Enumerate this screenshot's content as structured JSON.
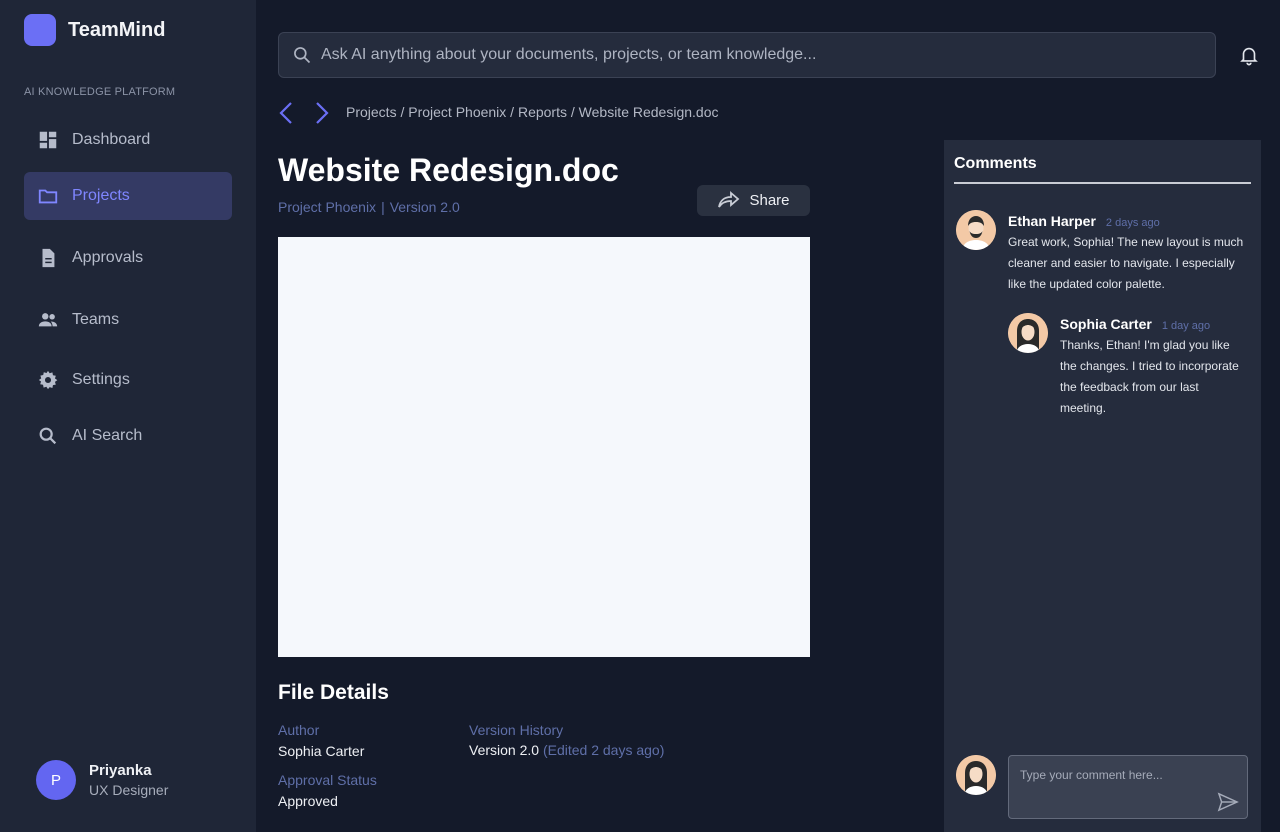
{
  "brand": {
    "name": "TeamMind",
    "logo_color": "#6b6ff5"
  },
  "sidebar": {
    "section_label": "AI KNOWLEDGE PLATFORM",
    "items": [
      {
        "label": "Dashboard",
        "icon": "dashboard-icon",
        "active": false
      },
      {
        "label": "Projects",
        "icon": "folder-icon",
        "active": true
      },
      {
        "label": "Approvals",
        "icon": "document-icon",
        "active": false
      },
      {
        "label": "Teams",
        "icon": "people-icon",
        "active": false
      },
      {
        "label": "Settings",
        "icon": "gear-icon",
        "active": false
      },
      {
        "label": "AI Search",
        "icon": "search-icon",
        "active": false
      }
    ],
    "user": {
      "initial": "P",
      "name": "Priyanka",
      "role": "UX Designer"
    }
  },
  "search": {
    "placeholder": "Ask AI anything about your documents, projects, or team knowledge..."
  },
  "breadcrumb": {
    "path": "Projects / Project Phoenix / Reports /  Website Redesign.doc"
  },
  "document": {
    "title": "Website Redesign.doc",
    "project": "Project Phoenix",
    "version": "Version 2.0",
    "share_label": "Share"
  },
  "file_details": {
    "title": "File Details",
    "author_label": "Author",
    "author": "Sophia Carter",
    "approval_label": "Approval Status",
    "approval": "Approved",
    "version_history_label": "Version History",
    "version": "Version 2.0",
    "edited": "(Edited 2 days ago)"
  },
  "comments": {
    "title": "Comments",
    "items": [
      {
        "author": "Ethan Harper",
        "time": "2 days ago",
        "text": "Great work, Sophia! The new layout is much cleaner and easier to navigate. I especially like the updated color palette."
      },
      {
        "author": "Sophia Carter",
        "time": "1 day ago",
        "text": "Thanks, Ethan! I'm glad you like the changes. I tried to incorporate the feedback from our last meeting."
      }
    ],
    "composer_placeholder": "Type your comment here..."
  },
  "colors": {
    "accent": "#6366f1",
    "background": "#141a2a",
    "sidebar": "#1f2637",
    "panel": "#252c3d"
  }
}
